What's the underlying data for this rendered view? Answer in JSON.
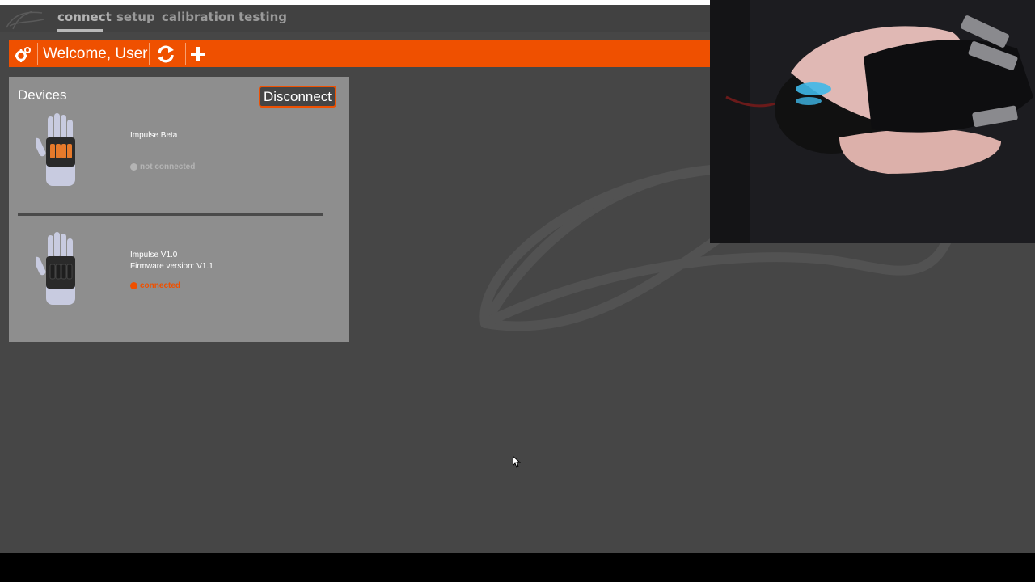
{
  "nav": {
    "tabs": [
      {
        "label": "connect",
        "active": true
      },
      {
        "label": "setup",
        "active": false
      },
      {
        "label": "calibration",
        "active": false
      },
      {
        "label": "testing",
        "active": false
      }
    ]
  },
  "toolbar": {
    "welcome": "Welcome, User",
    "icons": [
      "gear-icon",
      "refresh-icon",
      "plus-icon"
    ],
    "accent_color": "#ef5000"
  },
  "devices_panel": {
    "title": "Devices",
    "disconnect_label": "Disconnect",
    "devices": [
      {
        "name": "Impulse Beta",
        "firmware": "",
        "status": "not connected",
        "status_color": "#b4b4b4",
        "glove_accent": "#e77a2b"
      },
      {
        "name": "Impulse V1.0",
        "firmware": "Firmware version: V1.1",
        "status": "connected",
        "status_color": "#ef5000",
        "glove_accent": "#2a2a2a"
      }
    ]
  }
}
